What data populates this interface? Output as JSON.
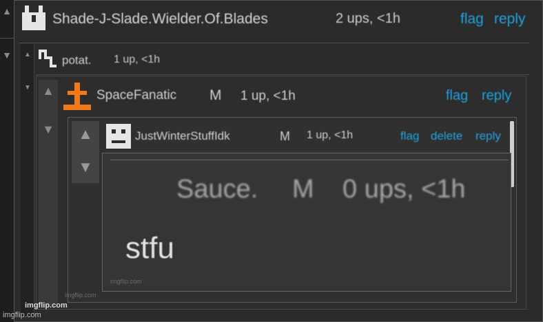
{
  "comments": [
    {
      "username": "Shade-J-Slade.Wielder.Of.Blades",
      "badge": "",
      "meta": "2 ups, <1h",
      "actions": [
        "flag",
        "reply"
      ]
    },
    {
      "username": "potat.",
      "badge": "",
      "meta": "1 up, <1h",
      "actions": []
    },
    {
      "username": "SpaceFanatic",
      "badge": "M",
      "meta": "1 up, <1h",
      "actions": [
        "flag",
        "reply"
      ]
    },
    {
      "username": "JustWinterStuffIdk",
      "badge": "M",
      "meta": "1 up, <1h",
      "actions": [
        "flag",
        "delete",
        "reply"
      ]
    },
    {
      "username": "Sauce.",
      "badge": "M",
      "meta": "0 ups, <1h",
      "body": "stfu"
    }
  ],
  "watermarks": {
    "small": "imgflip.com",
    "main": "imgflip.com"
  },
  "colors": {
    "link": "#1fa3e0",
    "avatar_orange": "#f07a17",
    "background": "#2f2f2f"
  },
  "icons": {
    "upvote": "▲",
    "downvote": "▼"
  }
}
